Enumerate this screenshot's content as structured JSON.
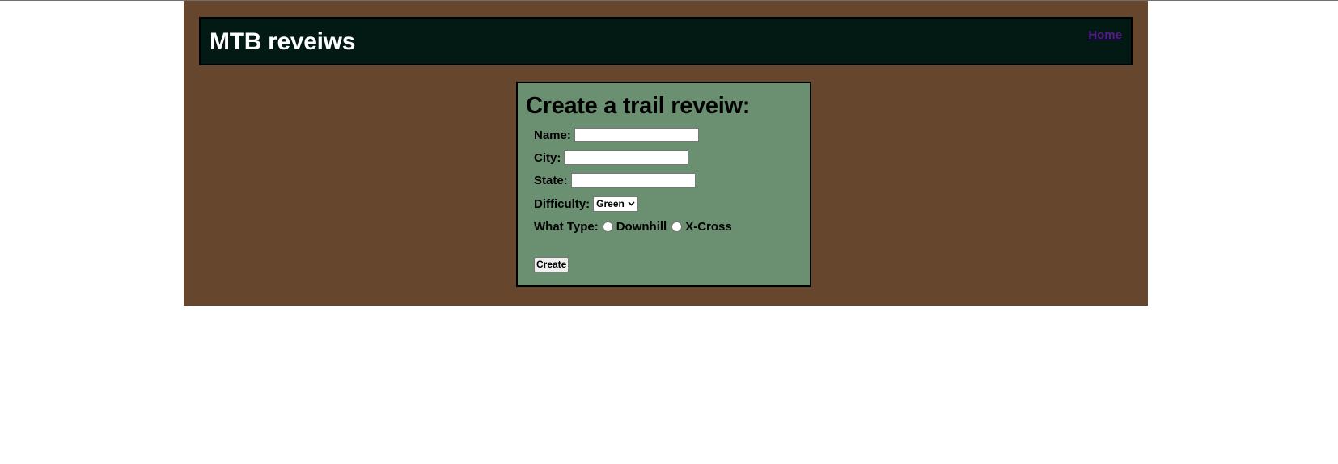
{
  "header": {
    "site_title": "MTB reveiws",
    "nav": {
      "home_label": "Home"
    }
  },
  "form": {
    "title": "Create a trail reveiw:",
    "fields": {
      "name": {
        "label": "Name:",
        "value": ""
      },
      "city": {
        "label": "City:",
        "value": ""
      },
      "state": {
        "label": "State:",
        "value": ""
      },
      "difficulty": {
        "label": "Difficulty:",
        "selected": "Green"
      },
      "type": {
        "label": "What Type:",
        "options": [
          {
            "label": "Downhill",
            "checked": false
          },
          {
            "label": "X-Cross",
            "checked": false
          }
        ]
      }
    },
    "submit_label": "Create"
  },
  "colors": {
    "page_background": "#66472d",
    "header_background": "#031914",
    "form_background": "#6b8f71",
    "link": "#551a8b"
  },
  "icons": {
    "select_arrow": "chevron-down-icon"
  }
}
